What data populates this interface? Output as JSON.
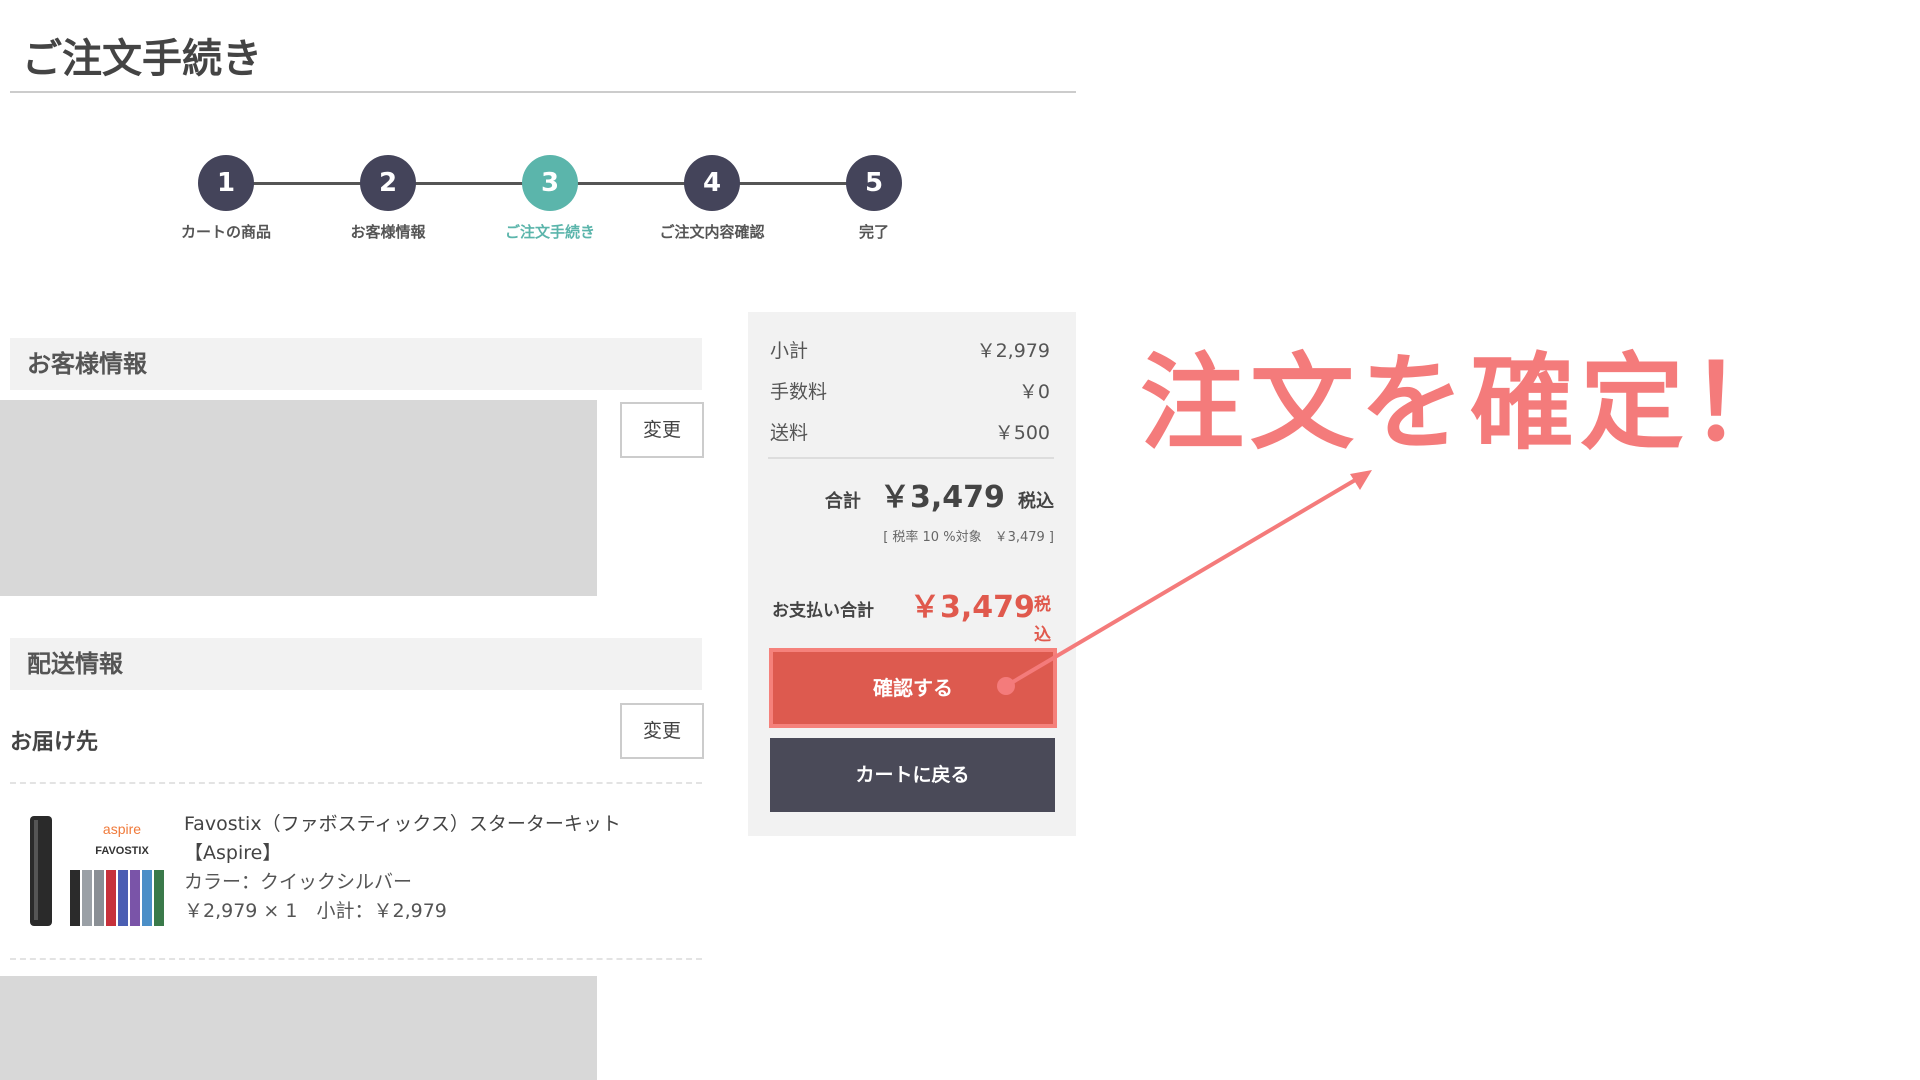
{
  "page": {
    "title": "ご注文手続き"
  },
  "stepper": {
    "steps": [
      {
        "number": "1",
        "label": "カートの商品"
      },
      {
        "number": "2",
        "label": "お客様情報"
      },
      {
        "number": "3",
        "label": "ご注文手続き"
      },
      {
        "number": "4",
        "label": "ご注文内容確認"
      },
      {
        "number": "5",
        "label": "完了"
      }
    ],
    "active_step": 3
  },
  "customer": {
    "heading": "お客様情報",
    "change_label": "変更"
  },
  "delivery": {
    "heading": "配送情報",
    "destination_label": "お届け先",
    "change_label": "変更",
    "product": {
      "brand_logo": "aspire",
      "product_logo": "FAVOSTIX",
      "name_line1": "Favostix（ファボスティックス）スターターキット",
      "name_line2": "【Aspire】",
      "color": "カラー：クイックシルバー",
      "price_line": "￥2,979 × 1　小計：￥2,979"
    }
  },
  "summary": {
    "subtotal_label": "小計",
    "subtotal_value": "￥2,979",
    "fee_label": "手数料",
    "fee_value": "￥0",
    "shipping_label": "送料",
    "shipping_value": "￥500",
    "total_label": "合計",
    "total_value": "￥3,479",
    "total_tax": "税込",
    "tax_note": "[ 税率 10 %対象　￥3,479 ]",
    "payment_label": "お支払い合計",
    "payment_value": "￥3,479",
    "payment_tax": "税込",
    "confirm_label": "確認する",
    "back_label": "カートに戻る"
  },
  "annotation": {
    "text": "注文を確定！",
    "color": "#f47b7b"
  },
  "colors": {
    "accent_teal": "#5bb5ab",
    "step_dark": "#44445a",
    "confirm_red": "#dd5a4f",
    "price_red": "#e0594d"
  }
}
